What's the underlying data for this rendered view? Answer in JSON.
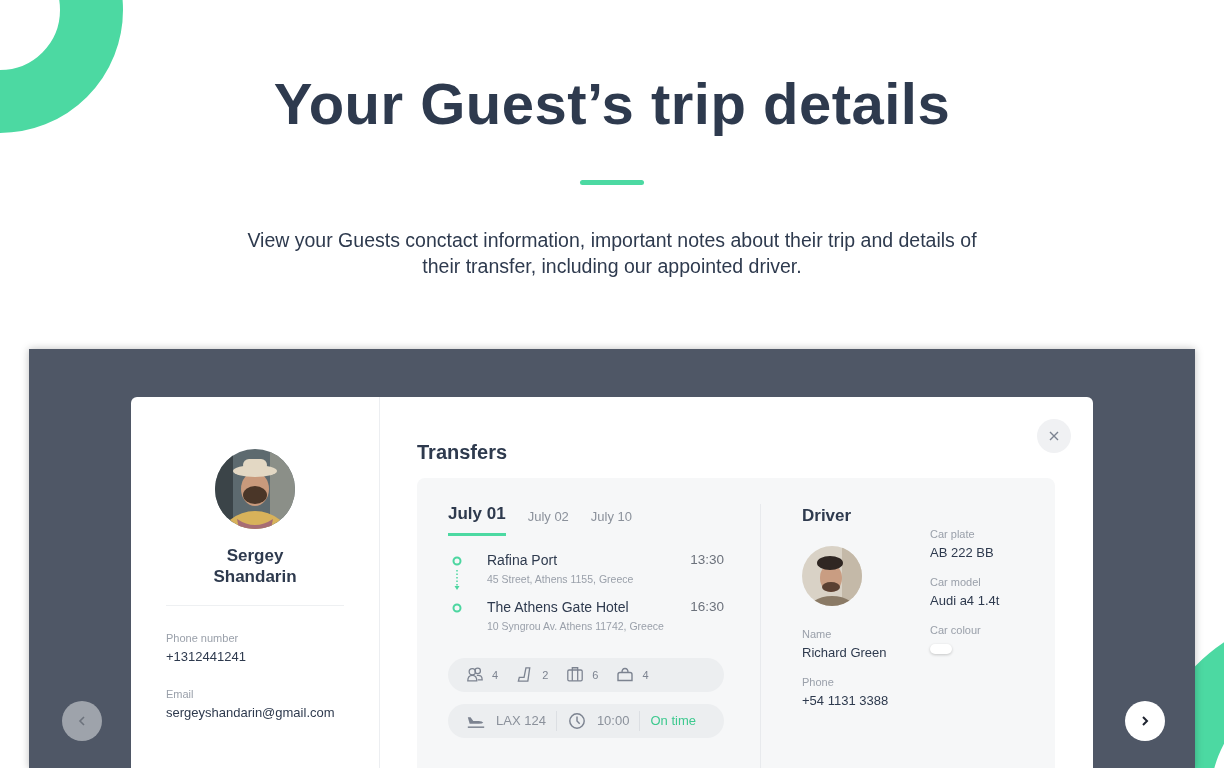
{
  "heading": {
    "title": "Your Guest’s trip details",
    "description": "View your Guests conctact information, important notes about their trip and details of their transfer, including our appointed driver."
  },
  "guest": {
    "name": "Sergey Shandarin",
    "fields": [
      {
        "label": "Phone number",
        "value": "+1312441241"
      },
      {
        "label": "Email",
        "value": "sergeyshandarin@gmail.com"
      }
    ]
  },
  "transfers": {
    "title": "Transfers",
    "tabs": [
      {
        "label": "July 01",
        "selected": true
      },
      {
        "label": "July 02",
        "selected": false
      },
      {
        "label": "July 10",
        "selected": false
      }
    ],
    "stops": [
      {
        "name": "Rafina Port",
        "address": "45 Street, Athens 1155, Greece",
        "time": "13:30"
      },
      {
        "name": "The Athens Gate Hotel",
        "address": "10 Syngrou Av. Athens 11742, Greece",
        "time": "16:30"
      }
    ],
    "amenities": [
      {
        "kind": "passengers",
        "count": "4"
      },
      {
        "kind": "seat",
        "count": "2"
      },
      {
        "kind": "suitcase",
        "count": "6"
      },
      {
        "kind": "bag",
        "count": "4"
      }
    ],
    "flight": {
      "number": "LAX 124",
      "time": "10:00",
      "status": "On time"
    }
  },
  "driver": {
    "title": "Driver",
    "fields": [
      {
        "label": "Name",
        "value": "Richard Green"
      },
      {
        "label": "Phone",
        "value": "+54 1131 3388"
      }
    ],
    "car": [
      {
        "kind": "text",
        "label": "Car plate",
        "value": "AB 222 BB"
      },
      {
        "kind": "text",
        "label": "Car model",
        "value": "Audi a4 1.4t"
      },
      {
        "kind": "swatch",
        "label": "Car colour",
        "color": "#ffffff"
      }
    ]
  }
}
